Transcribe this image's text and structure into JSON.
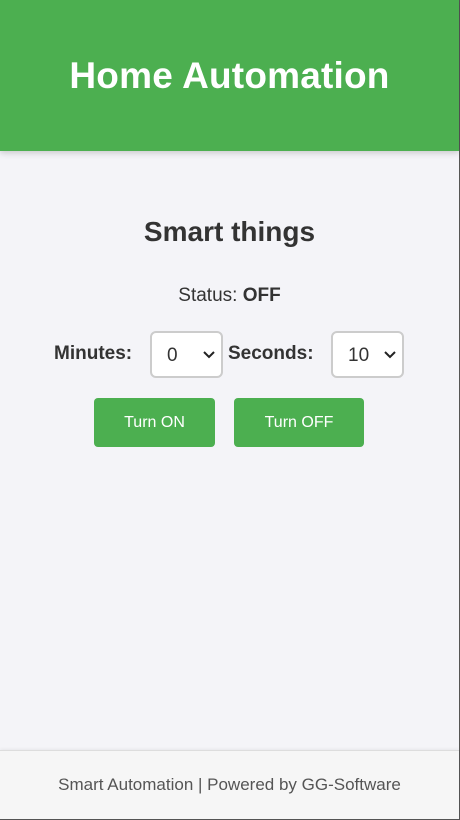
{
  "header": {
    "title": "Home Automation"
  },
  "main": {
    "section_title": "Smart things",
    "status": {
      "label": "Status:",
      "value": "OFF"
    },
    "timer": {
      "minutes_label": "Minutes:",
      "minutes_value": "0",
      "seconds_label": "Seconds:",
      "seconds_value": "10"
    },
    "buttons": {
      "on_label": "Turn ON",
      "off_label": "Turn OFF"
    }
  },
  "footer": {
    "text": "Smart Automation | Powered by GG-Software"
  },
  "colors": {
    "accent": "#4caf50",
    "background": "#f4f4f8",
    "text": "#333333",
    "footer_text": "#555555"
  },
  "icons": {
    "select_arrow": "chevron-down-icon"
  }
}
